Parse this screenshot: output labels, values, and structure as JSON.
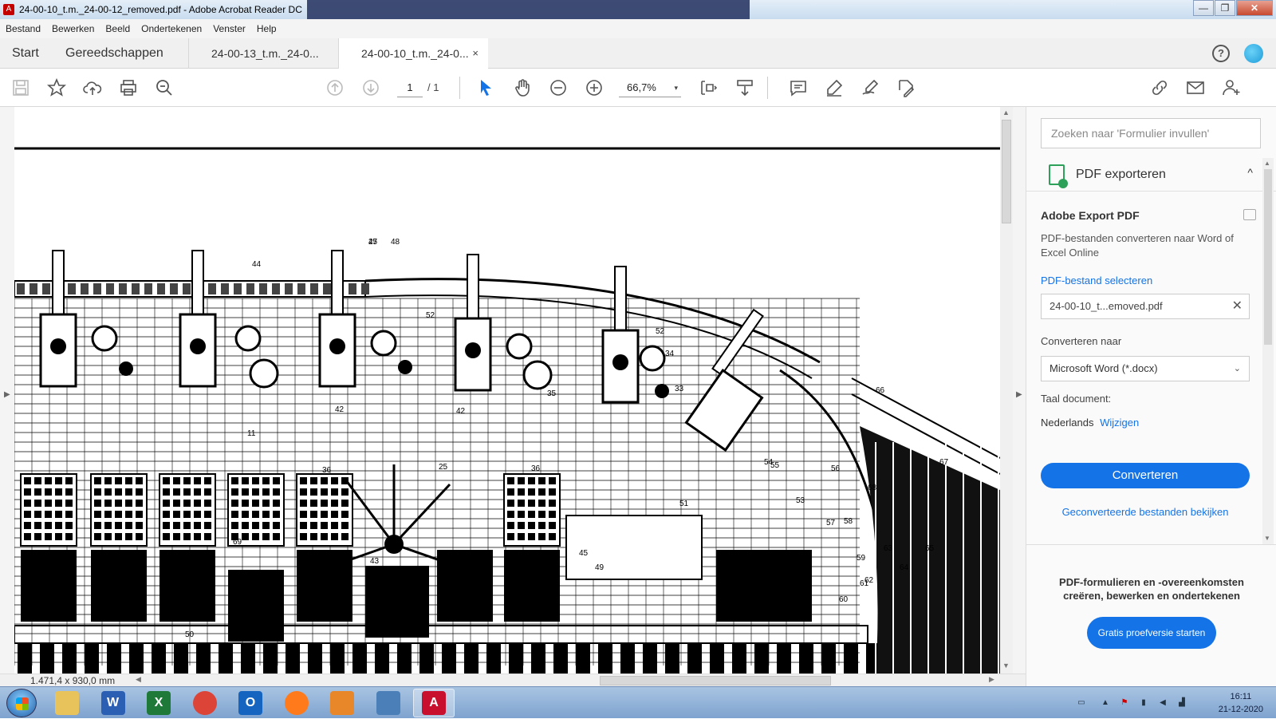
{
  "window": {
    "title": "24-00-10_t.m._24-00-12_removed.pdf - Adobe Acrobat Reader DC",
    "controls": {
      "minimize": "—",
      "maximize": "❐",
      "close": "✕"
    }
  },
  "menu": [
    "Bestand",
    "Bewerken",
    "Beeld",
    "Ondertekenen",
    "Venster",
    "Help"
  ],
  "tabs": {
    "home": "Start",
    "tools": "Gereedschappen",
    "documents": [
      {
        "label": "24-00-13_t.m._24-0...",
        "active": false
      },
      {
        "label": "24-00-10_t.m._24-0...",
        "active": true,
        "close": "×"
      }
    ]
  },
  "toolbar": {
    "page_current": "1",
    "page_total": "/ 1",
    "zoom": "66,7%",
    "zoom_caret": "▾"
  },
  "document": {
    "dimensions": "1.471,4 x 930,0 mm",
    "drawing_labels": [
      "47",
      "48",
      "44",
      "52",
      "52",
      "34",
      "33",
      "35",
      "42",
      "42",
      "11",
      "36",
      "25",
      "36",
      "51",
      "53",
      "54",
      "55",
      "56",
      "57",
      "58",
      "59",
      "60",
      "61",
      "62",
      "63",
      "64",
      "65",
      "66",
      "67",
      "68",
      "69",
      "43",
      "45",
      "49",
      "50",
      "25"
    ]
  },
  "panel": {
    "search_placeholder": "Zoeken naar 'Formulier invullen'",
    "section_title": "PDF exporteren",
    "chevron": "^",
    "service_title": "Adobe Export PDF",
    "service_desc": "PDF-bestanden converteren naar Word of Excel Online",
    "select_file_link": "PDF-bestand selecteren",
    "selected_file": "24-00-10_t...emoved.pdf",
    "clear": "✕",
    "convert_to_label": "Converteren naar",
    "convert_to_value": "Microsoft Word (*.docx)",
    "select_caret": "⌄",
    "language_label": "Taal document:",
    "language_value": "Nederlands",
    "change_link": "Wijzigen",
    "convert_button": "Converteren",
    "view_converted_link": "Geconverteerde bestanden bekijken",
    "promo_text": "PDF-formulieren en -overeenkomsten creëren, bewerken en ondertekenen",
    "trial_button": "Gratis proefversie starten"
  },
  "taskbar": {
    "apps": [
      {
        "name": "explorer",
        "glyph": "",
        "color": "#e8c25a"
      },
      {
        "name": "word",
        "glyph": "W",
        "color": "#2b5fb4"
      },
      {
        "name": "excel",
        "glyph": "X",
        "color": "#1f7a3a"
      },
      {
        "name": "chrome",
        "glyph": "",
        "color": "#db4437"
      },
      {
        "name": "outlook",
        "glyph": "O",
        "color": "#1565c0"
      },
      {
        "name": "firefox",
        "glyph": "",
        "color": "#ff7a1a"
      },
      {
        "name": "app-flame",
        "glyph": "",
        "color": "#e8872a"
      },
      {
        "name": "photos",
        "glyph": "",
        "color": "#4a7fb8"
      },
      {
        "name": "acrobat",
        "glyph": "A",
        "color": "#c8102e"
      }
    ],
    "time": "16:11",
    "date": "21-12-2020"
  }
}
